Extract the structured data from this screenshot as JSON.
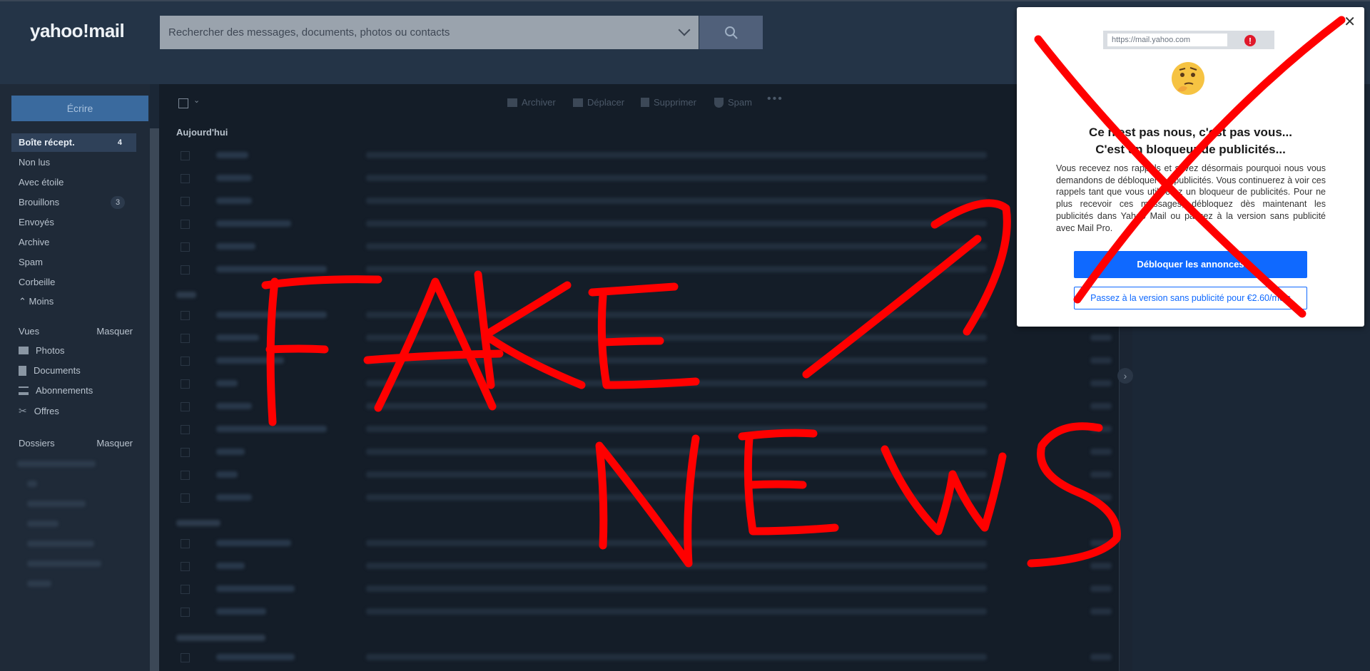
{
  "header": {
    "logo": "yahoo!mail",
    "search_placeholder": "Rechercher des messages, documents, photos ou contacts"
  },
  "sidebar": {
    "compose_label": "Écrire",
    "folders": [
      {
        "label": "Boîte récept.",
        "count": "4"
      },
      {
        "label": "Non lus",
        "count": ""
      },
      {
        "label": "Avec étoile",
        "count": ""
      },
      {
        "label": "Brouillons",
        "count": "3"
      },
      {
        "label": "Envoyés",
        "count": ""
      },
      {
        "label": "Archive",
        "count": ""
      },
      {
        "label": "Spam",
        "count": ""
      },
      {
        "label": "Corbeille",
        "count": ""
      }
    ],
    "less_label": "Moins",
    "views_label": "Vues",
    "views_hide": "Masquer",
    "views": [
      {
        "label": "Photos",
        "icon": "image-icon"
      },
      {
        "label": "Documents",
        "icon": "document-icon"
      },
      {
        "label": "Abonnements",
        "icon": "subscriptions-icon"
      },
      {
        "label": "Offres",
        "icon": "scissors-icon"
      }
    ],
    "folders_label": "Dossiers",
    "folders_hide": "Masquer"
  },
  "toolbar": {
    "archive": "Archiver",
    "move": "Déplacer",
    "delete": "Supprimer",
    "spam": "Spam"
  },
  "list": {
    "group_today": "Aujourd'hui"
  },
  "popup": {
    "url": "https://mail.yahoo.com",
    "title_line1": "Ce n'est pas nous, c'est pas vous...",
    "title_line2": "C'est un bloqueur de publicités...",
    "body": "Vous recevez nos rappels et savez désormais pourquoi nous vous demandons de débloquer les publicités. Vous continuerez à voir ces rappels tant que vous utiliserez un bloqueur de publicités. Pour ne plus recevoir ces messages, débloquez dès maintenant les publicités dans Yahoo Mail ou passez à la version sans publicité avec Mail Pro.",
    "primary_button": "Débloquer les annonces",
    "secondary_button": "Passez à la version sans publicité pour €2.60/mois"
  },
  "annotation": {
    "line1": "FAKE",
    "line2": "NEWS",
    "color": "#ff0000"
  }
}
